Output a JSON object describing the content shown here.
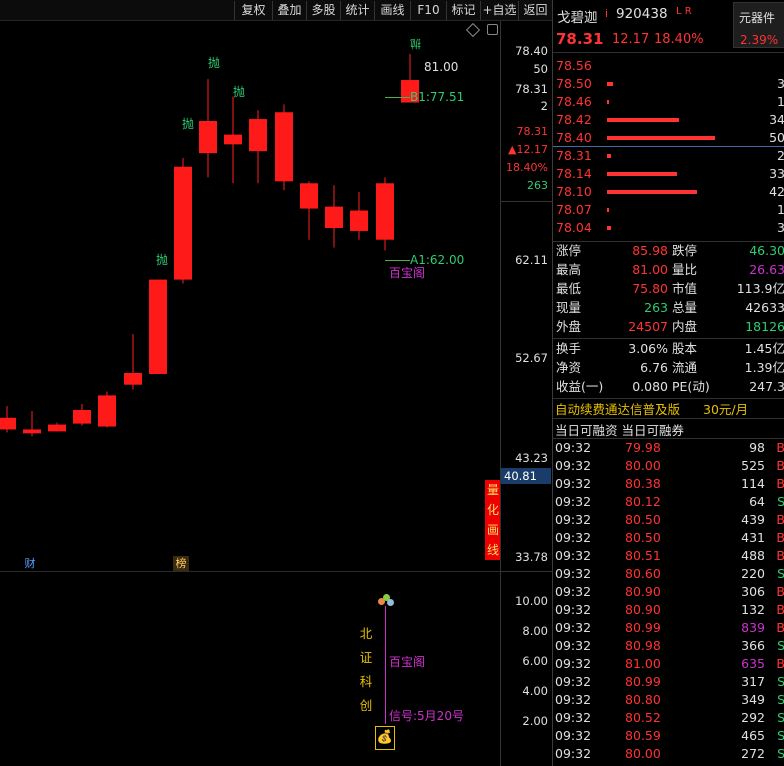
{
  "toolbar": {
    "items": [
      "复权",
      "叠加",
      "多股",
      "统计",
      "画线",
      "F10",
      "标记",
      "+自选",
      "返回"
    ]
  },
  "chart": {
    "candles": [
      {
        "o": 43.6,
        "c": 42.4,
        "h": 44.8,
        "l": 42.1
      },
      {
        "o": 42.4,
        "c": 42.0,
        "h": 44.3,
        "l": 41.7
      },
      {
        "o": 42.2,
        "c": 42.9,
        "h": 43.1,
        "l": 42.2
      },
      {
        "o": 43.0,
        "c": 44.4,
        "h": 45.0,
        "l": 42.8
      },
      {
        "o": 42.7,
        "c": 45.9,
        "h": 46.3,
        "l": 42.6
      },
      {
        "o": 47.0,
        "c": 48.2,
        "h": 52.2,
        "l": 46.5
      },
      {
        "o": 48.1,
        "c": 57.8,
        "h": 57.8,
        "l": 48.1
      },
      {
        "o": 57.8,
        "c": 69.4,
        "h": 70.3,
        "l": 57.4
      },
      {
        "o": 70.8,
        "c": 74.1,
        "h": 78.4,
        "l": 68.3
      },
      {
        "o": 72.7,
        "c": 71.7,
        "h": 76.6,
        "l": 67.7
      },
      {
        "o": 71.0,
        "c": 74.3,
        "h": 75.2,
        "l": 67.7
      },
      {
        "o": 75.0,
        "c": 67.9,
        "h": 75.8,
        "l": 67.0
      },
      {
        "o": 67.7,
        "c": 65.1,
        "h": 67.9,
        "l": 61.9
      },
      {
        "o": 65.3,
        "c": 63.1,
        "h": 67.5,
        "l": 61.1
      },
      {
        "o": 64.9,
        "c": 62.8,
        "h": 66.8,
        "l": 61.9
      },
      {
        "o": 61.9,
        "c": 67.7,
        "h": 68.3,
        "l": 60.8
      },
      {
        "o": 76.0,
        "c": 78.31,
        "h": 81.0,
        "l": 76.0
      }
    ],
    "pao_label": "抛",
    "sell_label": "抛",
    "high_mark": "81.00",
    "b1_label": "B1:77.51",
    "a1_label": "A1:62.00",
    "baobao_label": "百宝阁",
    "cai_label": "财",
    "bang_label": "榜",
    "vertical_labels": [
      "量",
      "化",
      "画",
      "线"
    ]
  },
  "axis": {
    "main_ticks": [
      "78.40",
      "50",
      "78.31",
      "2",
      "62.11",
      "52.67",
      "43.23",
      "33.78"
    ],
    "current_price": "40.81",
    "lower_ticks": [
      "10.00",
      "8.00",
      "6.00",
      "4.00",
      "2.00"
    ],
    "side_price": "78.31",
    "side_change": "▲12.17",
    "side_pct": "18.40%",
    "side_vol": "263"
  },
  "lower_panel": {
    "bz_vertical": [
      "北",
      "证",
      "科",
      "创"
    ],
    "baobao": "百宝阁",
    "signal": "信号:5月20号"
  },
  "right_panel": {
    "stock_name": "戈碧迦",
    "stock_suffix": "i",
    "code": "920438",
    "flags": "L R",
    "sector": "元器件",
    "sector_pct": "2.39%",
    "price": "78.31",
    "change": "12.17",
    "change_pct": "18.40%",
    "asks": [
      {
        "p": "78.56",
        "v": "",
        "w": 0
      },
      {
        "p": "78.50",
        "v": "3",
        "w": 6
      },
      {
        "p": "78.46",
        "v": "1",
        "w": 2
      },
      {
        "p": "78.42",
        "v": "34",
        "w": 72
      },
      {
        "p": "78.40",
        "v": "50",
        "w": 108
      }
    ],
    "bids": [
      {
        "p": "78.31",
        "v": "2",
        "w": 4
      },
      {
        "p": "78.14",
        "v": "33",
        "w": 70
      },
      {
        "p": "78.10",
        "v": "42",
        "w": 90
      },
      {
        "p": "78.07",
        "v": "1",
        "w": 2
      },
      {
        "p": "78.04",
        "v": "3",
        "w": 4
      }
    ],
    "stats": [
      {
        "l1": "涨停",
        "v1": "85.98",
        "c1": "red",
        "l2": "跌停",
        "v2": "46.30",
        "c2": "green"
      },
      {
        "l1": "最高",
        "v1": "81.00",
        "c1": "red",
        "l2": "量比",
        "v2": "26.63",
        "c2": "purple"
      },
      {
        "l1": "最低",
        "v1": "75.80",
        "c1": "red",
        "l2": "市值",
        "v2": "113.9亿",
        "c2": "white"
      },
      {
        "l1": "现量",
        "v1": "263",
        "c1": "green",
        "l2": "总量",
        "v2": "42633",
        "c2": "white"
      },
      {
        "l1": "外盘",
        "v1": "24507",
        "c1": "red",
        "l2": "内盘",
        "v2": "18126",
        "c2": "green"
      }
    ],
    "stats2": [
      {
        "l1": "换手",
        "v1": "3.06%",
        "l2": "股本",
        "v2": "1.45亿"
      },
      {
        "l1": "净资",
        "v1": "6.76",
        "l2": "流通",
        "v2": "1.39亿"
      },
      {
        "l1": "收益(一)",
        "v1": "0.080",
        "l2": "PE(动)",
        "v2": "247.3"
      }
    ],
    "promo": "自动续费通达信普及版",
    "promo_price": "30元/月",
    "rong_tabs": "当日可融资 当日可融券",
    "ticks": [
      {
        "t": "09:32",
        "p": "79.98",
        "v": "98",
        "s": "B",
        "pc": "red",
        "vc": "white"
      },
      {
        "t": "09:32",
        "p": "80.00",
        "v": "525",
        "s": "B",
        "pc": "red",
        "vc": "white"
      },
      {
        "t": "09:32",
        "p": "80.38",
        "v": "114",
        "s": "B",
        "pc": "red",
        "vc": "white"
      },
      {
        "t": "09:32",
        "p": "80.12",
        "v": "64",
        "s": "S",
        "pc": "red",
        "vc": "white"
      },
      {
        "t": "09:32",
        "p": "80.50",
        "v": "439",
        "s": "B",
        "pc": "red",
        "vc": "white"
      },
      {
        "t": "09:32",
        "p": "80.50",
        "v": "431",
        "s": "B",
        "pc": "red",
        "vc": "white"
      },
      {
        "t": "09:32",
        "p": "80.51",
        "v": "488",
        "s": "B",
        "pc": "red",
        "vc": "white"
      },
      {
        "t": "09:32",
        "p": "80.60",
        "v": "220",
        "s": "S",
        "pc": "red",
        "vc": "white"
      },
      {
        "t": "09:32",
        "p": "80.90",
        "v": "306",
        "s": "B",
        "pc": "red",
        "vc": "white"
      },
      {
        "t": "09:32",
        "p": "80.90",
        "v": "132",
        "s": "B",
        "pc": "red",
        "vc": "white"
      },
      {
        "t": "09:32",
        "p": "80.99",
        "v": "839",
        "s": "B",
        "pc": "red",
        "vc": "purple"
      },
      {
        "t": "09:32",
        "p": "80.98",
        "v": "366",
        "s": "S",
        "pc": "red",
        "vc": "white"
      },
      {
        "t": "09:32",
        "p": "81.00",
        "v": "635",
        "s": "B",
        "pc": "red",
        "vc": "purple"
      },
      {
        "t": "09:32",
        "p": "80.99",
        "v": "317",
        "s": "S",
        "pc": "red",
        "vc": "white"
      },
      {
        "t": "09:32",
        "p": "80.80",
        "v": "349",
        "s": "S",
        "pc": "red",
        "vc": "white"
      },
      {
        "t": "09:32",
        "p": "80.52",
        "v": "292",
        "s": "S",
        "pc": "red",
        "vc": "white"
      },
      {
        "t": "09:32",
        "p": "80.59",
        "v": "465",
        "s": "S",
        "pc": "red",
        "vc": "white"
      },
      {
        "t": "09:32",
        "p": "80.00",
        "v": "272",
        "s": "S",
        "pc": "red",
        "vc": "white"
      }
    ]
  }
}
